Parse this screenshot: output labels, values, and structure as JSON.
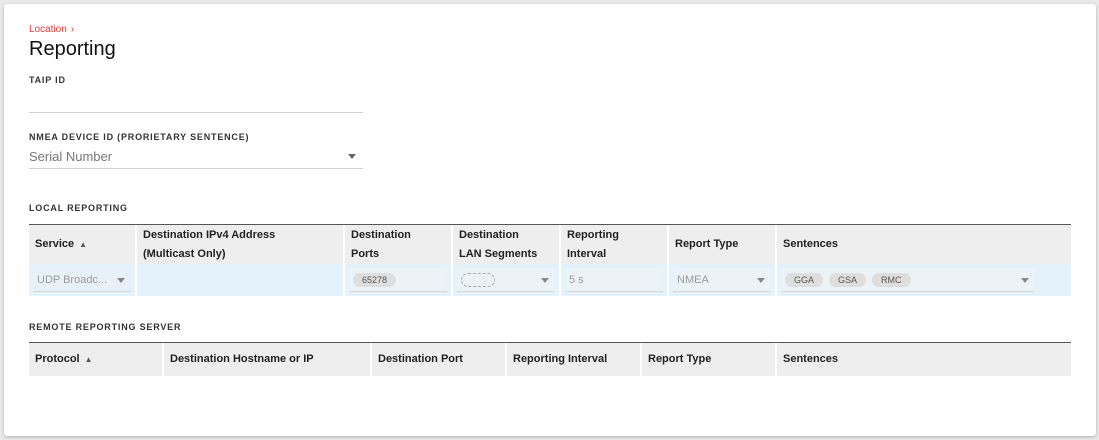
{
  "breadcrumb": {
    "parent": "Location"
  },
  "page": {
    "title": "Reporting"
  },
  "taip": {
    "label": "TAIP ID",
    "value": ""
  },
  "nmea": {
    "label": "NMEA DEVICE ID (PRORIETARY SENTENCE)",
    "value": "Serial Number"
  },
  "local": {
    "section_label": "LOCAL REPORTING",
    "columns": {
      "service": "Service",
      "dest_ip_1": "Destination IPv4 Address",
      "dest_ip_2": "(Multicast Only)",
      "dest_ports_1": "Destination",
      "dest_ports_2": "Ports",
      "dest_lan_1": "Destination",
      "dest_lan_2": "LAN Segments",
      "interval_1": "Reporting",
      "interval_2": "Interval",
      "report_type": "Report Type",
      "sentences": "Sentences"
    },
    "row": {
      "service": "UDP Broadc...",
      "dest_ip": "",
      "port_chip": "65278",
      "interval": "5 s",
      "report_type": "NMEA",
      "sentence_chips": [
        "GGA",
        "GSA",
        "RMC"
      ]
    }
  },
  "remote": {
    "section_label": "REMOTE REPORTING SERVER",
    "columns": {
      "protocol": "Protocol",
      "hostname": "Destination Hostname or IP",
      "port": "Destination Port",
      "interval": "Reporting Interval",
      "report_type": "Report Type",
      "sentences": "Sentences"
    }
  },
  "colors": {
    "accent": "#e53935",
    "row_selected": "#e3f2fb",
    "header_bg": "#eeeeee"
  },
  "icons": {
    "breadcrumb_separator": "chevron-right-icon",
    "sort": "sort-ascending-icon",
    "dropdown": "caret-down-icon"
  }
}
